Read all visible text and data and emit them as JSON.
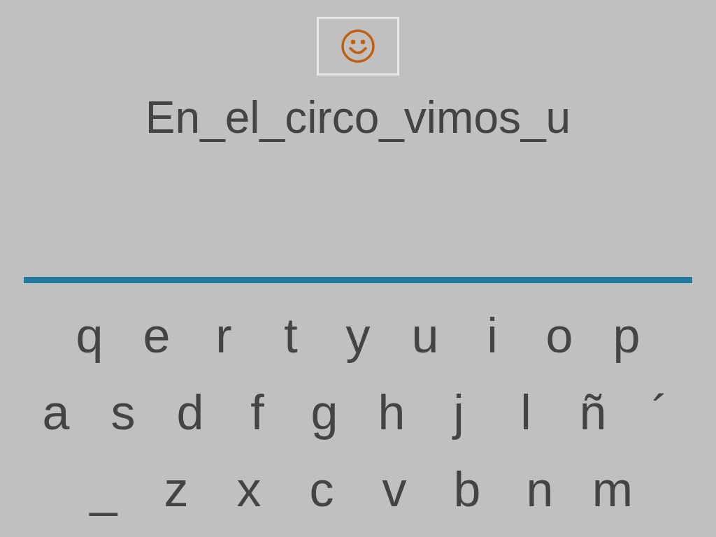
{
  "prompt": {
    "text": "En_el_circo_vimos_u"
  },
  "keyboard": {
    "rows": [
      [
        "q",
        "e",
        "r",
        "t",
        "y",
        "u",
        "i",
        "o",
        "p"
      ],
      [
        "a",
        "s",
        "d",
        "f",
        "g",
        "h",
        "j",
        "l",
        "ñ",
        "´"
      ],
      [
        "_",
        "z",
        "x",
        "c",
        "v",
        "b",
        "n",
        "m"
      ]
    ]
  }
}
